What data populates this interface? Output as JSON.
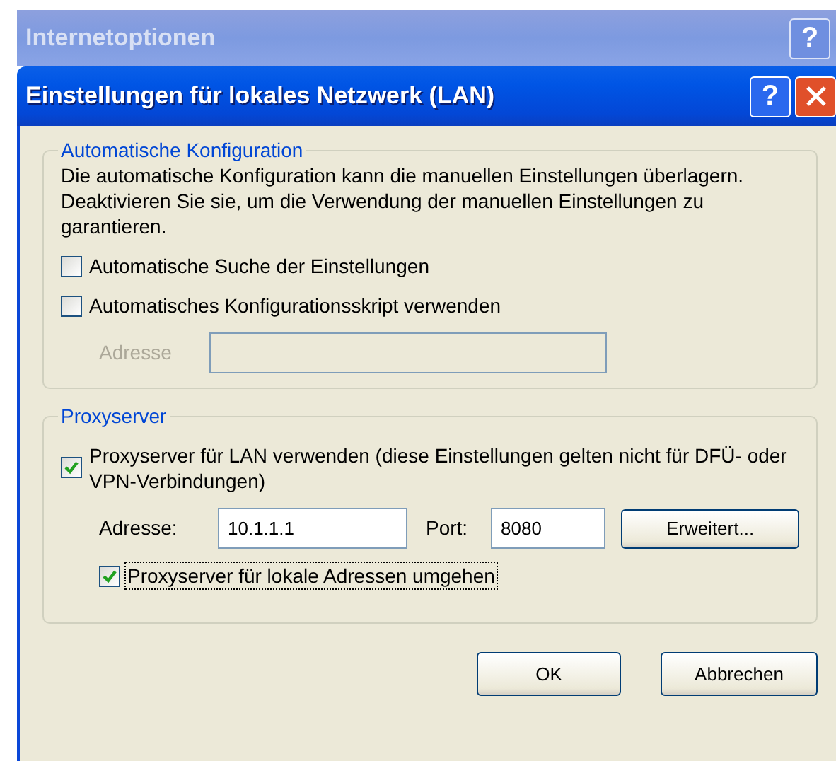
{
  "background_window": {
    "title": "Internetoptionen",
    "help_button": "?"
  },
  "dialog": {
    "title": "Einstellungen für lokales Netzwerk (LAN)",
    "help_button": "?"
  },
  "auto_config": {
    "legend": "Automatische Konfiguration",
    "description": "Die automatische Konfiguration kann die manuellen Einstellungen überlagern. Deaktivieren Sie sie, um die Verwendung der manuellen Einstellungen zu garantieren.",
    "options": [
      {
        "label": "Automatische Suche der Einstellungen",
        "checked": false
      },
      {
        "label": "Automatisches Konfigurationsskript verwenden",
        "checked": false
      }
    ],
    "script_address": {
      "label": "Adresse",
      "disabled": true
    }
  },
  "proxy": {
    "legend": "Proxyserver",
    "use_proxy": {
      "label": "Proxyserver für LAN verwenden (diese Einstellungen gelten nicht für DFÜ- oder VPN-Verbindungen)",
      "checked": true
    },
    "address_label": "Adresse:",
    "address": "10.1.1.1",
    "port_label": "Port:",
    "port": "8080",
    "advanced_button": "Erweitert...",
    "bypass_local": {
      "label": "Proxyserver für lokale Adressen umgehen",
      "checked": true,
      "focused": true
    }
  },
  "buttons": [
    {
      "label": "OK"
    },
    {
      "label": "Abbrechen"
    }
  ]
}
